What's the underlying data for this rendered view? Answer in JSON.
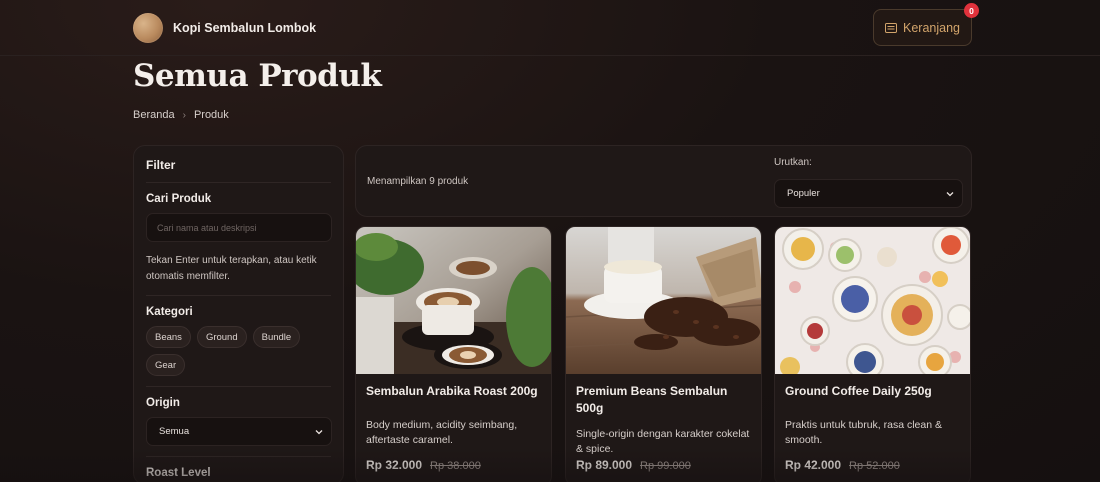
{
  "header": {
    "brand_name": "Kopi Sembalun Lombok",
    "cart_label": "Keranjang",
    "cart_count": "0"
  },
  "page": {
    "title": "Semua Produk",
    "breadcrumb": [
      "Beranda",
      "Produk"
    ]
  },
  "filter": {
    "title": "Filter",
    "search_label": "Cari Produk",
    "search_placeholder": "Cari nama atau deskripsi",
    "search_help": "Tekan Enter untuk terapkan, atau ketik otomatis memfilter.",
    "category_label": "Kategori",
    "categories": [
      "Beans",
      "Ground",
      "Bundle",
      "Gear"
    ],
    "origin_label": "Origin",
    "origin_value": "Semua",
    "roast_label": "Roast Level"
  },
  "toolbar": {
    "result_text": "Menampilkan 9 produk",
    "sort_label": "Urutkan:",
    "sort_value": "Populer"
  },
  "products": [
    {
      "name": "Sembalun Arabika Roast 200g",
      "description": "Body medium, acidity seimbang, aftertaste caramel.",
      "price": "Rp 32.000",
      "original_price": "Rp 38.000"
    },
    {
      "name": "Premium Beans Sembalun 500g",
      "description": "Single-origin dengan karakter cokelat & spice.",
      "price": "Rp 89.000",
      "original_price": "Rp 99.000"
    },
    {
      "name": "Ground Coffee Daily 250g",
      "description": "Praktis untuk tubruk, rasa clean & smooth.",
      "price": "Rp 42.000",
      "original_price": "Rp 52.000"
    }
  ],
  "colors": {
    "accent": "#d2a46b",
    "badge": "#e0323c",
    "background": "#1a1312",
    "card": "#1f1817"
  }
}
